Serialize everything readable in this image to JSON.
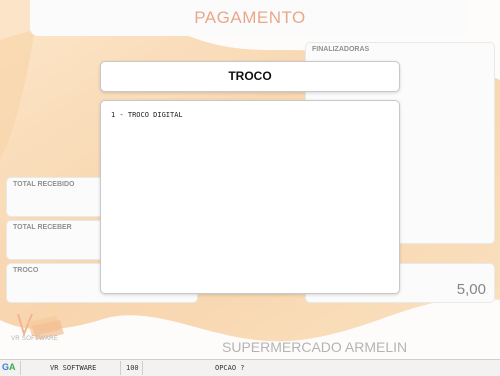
{
  "header": {
    "title": "PAGAMENTO"
  },
  "panels": {
    "finalizadoras": {
      "label": "FINALIZADORAS"
    },
    "total_recebido": {
      "label": "TOTAL RECEBIDO"
    },
    "total_receber": {
      "label": "TOTAL RECEBER"
    },
    "troco": {
      "label": "TROCO",
      "value": "5,00"
    }
  },
  "modal": {
    "title": "TROCO",
    "items": [
      "1 - TROCO DIGITAL"
    ]
  },
  "brand": {
    "logo_text": "VR SOFTWARE",
    "store_name": "SUPERMERCADO ARMELIN"
  },
  "statusbar": {
    "icon": "GA",
    "company": "VR SOFTWARE",
    "code": "100",
    "prompt": "OPCAO ?"
  },
  "colors": {
    "accent": "#d8602a",
    "orange": "#f0a040"
  }
}
